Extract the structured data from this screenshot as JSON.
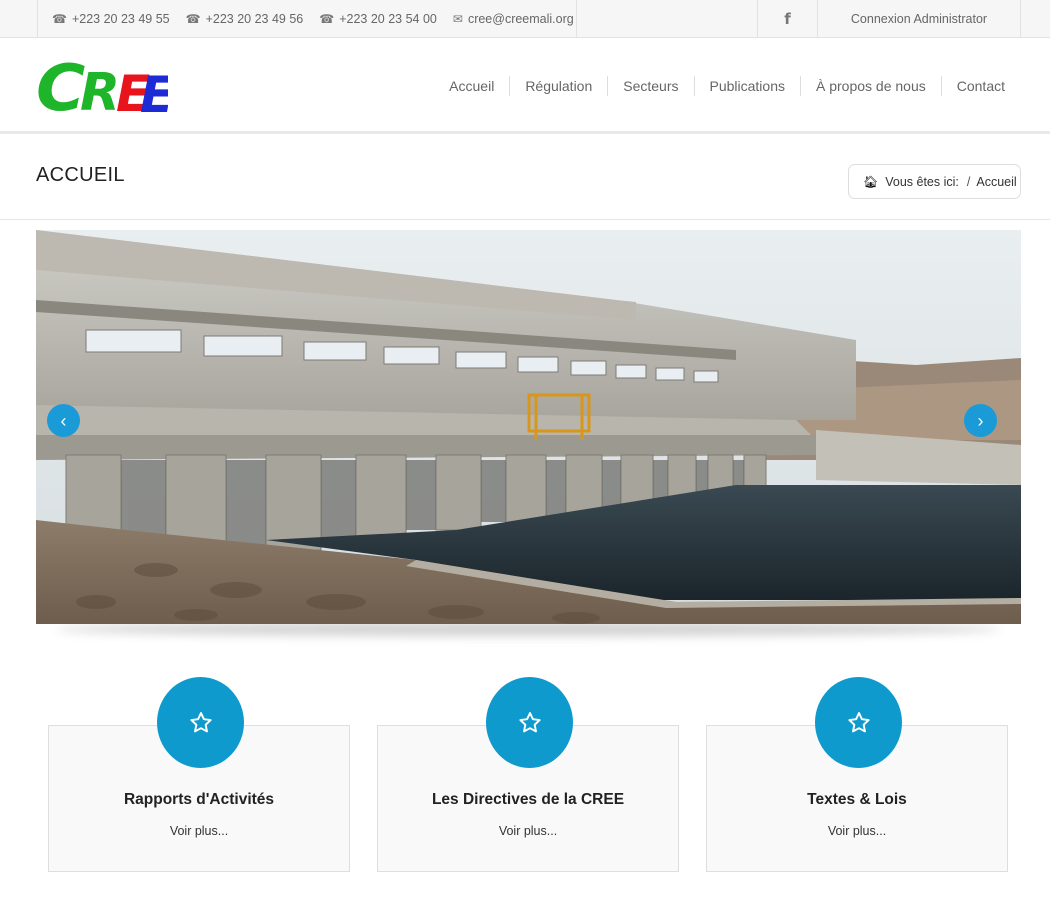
{
  "topbar": {
    "contacts": [
      {
        "icon": "phone-icon",
        "text": "+223 20 23 49 55"
      },
      {
        "icon": "phone-icon",
        "text": "+223 20 23 49 56"
      },
      {
        "icon": "phone-icon",
        "text": "+223 20 23 54 00"
      },
      {
        "icon": "envelope-icon",
        "text": "cree@creemali.org"
      }
    ],
    "social_icon": "facebook-icon",
    "admin_label": "Connexion Administrator"
  },
  "logo": {
    "text": "CREE",
    "colors": [
      "#1fb52a",
      "#1fb52a",
      "#e8141c",
      "#1d2bd6"
    ]
  },
  "nav": [
    "Accueil",
    "Régulation",
    "Secteurs",
    "Publications",
    "À propos de nous",
    "Contact"
  ],
  "page": {
    "title": "ACCUEIL",
    "breadcrumb": {
      "prefix": "Vous êtes ici:",
      "separator": "/",
      "current": "Accueil"
    }
  },
  "slider": {
    "prev_label": "‹",
    "next_label": "›",
    "image": "hydroelectric-dam-photo"
  },
  "features": [
    {
      "icon": "star-icon",
      "title": "Rapports d'Activités",
      "link": "Voir plus..."
    },
    {
      "icon": "star-icon",
      "title": "Les Directives de la CREE",
      "link": "Voir plus..."
    },
    {
      "icon": "star-icon",
      "title": "Textes & Lois",
      "link": "Voir plus..."
    }
  ],
  "colors": {
    "accent": "#0e9acd",
    "arrow": "#1a9ad6"
  }
}
